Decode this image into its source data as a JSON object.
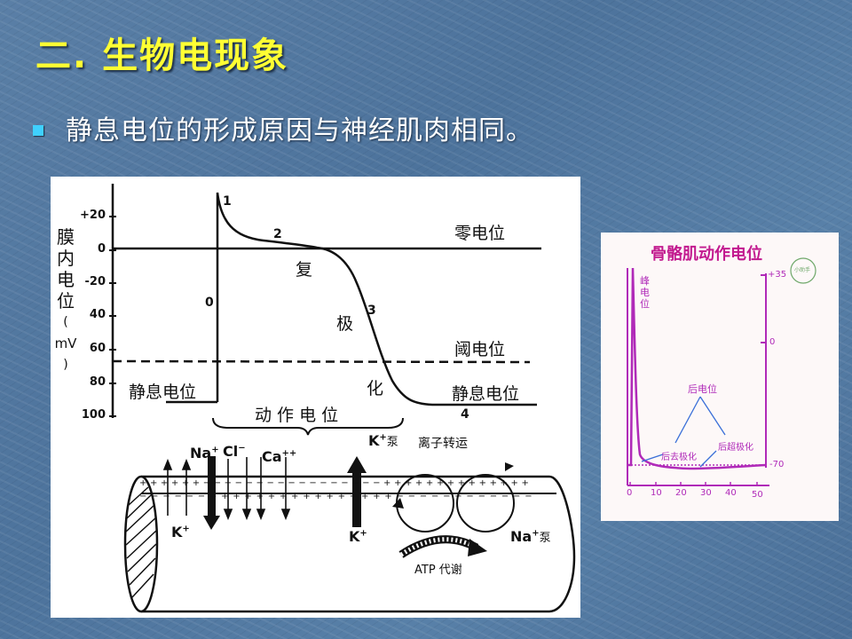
{
  "slide": {
    "title": "二. 生物电现象",
    "bullet": "静息电位的形成原因与神经肌肉相同。"
  },
  "diagram1": {
    "y_axis_label": [
      "膜",
      "内",
      "电",
      "位",
      "(",
      "mV",
      ")"
    ],
    "y_ticks": [
      "+20",
      "0",
      "-20",
      "40",
      "60",
      "80",
      "100"
    ],
    "phase_numbers": [
      "1",
      "2",
      "0",
      "3",
      "4"
    ],
    "labels": {
      "zero_potential": "零电位",
      "threshold_potential": "阈电位",
      "resting_left": "静息电位",
      "resting_right": "静息电位",
      "repol_1": "复",
      "repol_2": "极",
      "repol_3": "化",
      "action_potential": "动 作 电 位"
    },
    "ions": {
      "na": "Na",
      "na_sup": "+",
      "cl": "Cl",
      "cl_sup": "−",
      "ca": "Ca",
      "ca_sup": "++",
      "k_left": "K",
      "k_left_sup": "+",
      "k_pump": "K",
      "k_pump_sup": "+",
      "k_pump_suffix": "泵",
      "ion_transport": "离子转运",
      "k_right": "K",
      "k_right_sup": "+",
      "na_pump": "Na",
      "na_pump_sup": "+",
      "na_pump_suffix": "泵",
      "atp": "ATP 代谢"
    },
    "membrane_top_signs": "+ + + + + + − − − − − − − − − − − − − − − − − + + + + + + + + + + + + + +",
    "membrane_bottom_signs": "− − − − − − + + + + + + + + + + + + + + + + − − − − − − − − − − − −"
  },
  "diagram2": {
    "title": "骨骼肌动作电位",
    "peak_label": [
      "峰",
      "电",
      "位"
    ],
    "right_ticks": [
      "+35",
      "0",
      "-70"
    ],
    "x_ticks": [
      "0",
      "10",
      "20",
      "30",
      "40",
      "50"
    ],
    "after_potential": "后电位",
    "after_depolarization": "后去极化",
    "after_hyperpolarization": "后超极化",
    "logo_text": "小助手"
  },
  "colors": {
    "title": "#ffff33",
    "bullet": "#3fd0ff",
    "magenta": "#b02ab8",
    "blue_line": "#3a6fd8"
  }
}
